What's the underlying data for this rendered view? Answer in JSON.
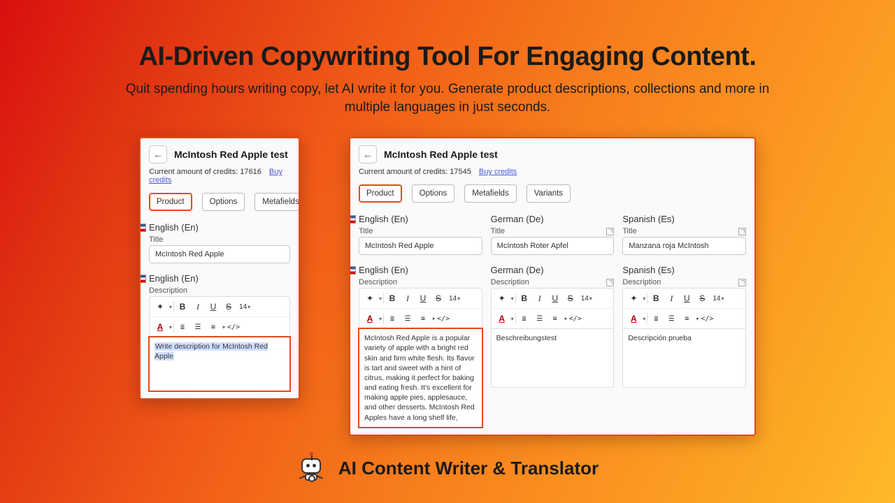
{
  "hero": {
    "title": "AI-Driven Copywriting Tool For Engaging Content.",
    "subtitle": "Quit spending hours writing copy, let AI write it for you. Generate product descriptions, collections and more in multiple languages in just seconds."
  },
  "footer": {
    "name": "AI Content Writer & Translator"
  },
  "left": {
    "product_title": "McIntosh Red Apple test",
    "credits_prefix": "Current amount of credits: ",
    "credits_value": "17616",
    "buy_link": "Buy credits",
    "tabs": [
      "Product",
      "Options",
      "Metafields"
    ],
    "lang": "English (En)",
    "title_label": "Title",
    "title_value": "McIntosh Red Apple",
    "desc_label": "Description",
    "prompt_text": "Write description for McIntosh Red Apple"
  },
  "right": {
    "product_title": "McIntosh Red Apple test",
    "credits_prefix": "Current amount of credits: ",
    "credits_value": "17545",
    "buy_link": "Buy credits",
    "tabs": [
      "Product",
      "Options",
      "Metafields",
      "Variants"
    ],
    "cols": [
      {
        "lang": "English (En)",
        "title_label": "Title",
        "title_value": "McIntosh Red Apple",
        "desc_label": "Description",
        "desc_value": "McIntosh Red Apple is a popular variety of apple with a bright red skin and firm white flesh. Its flavor is tart and sweet with a hint of citrus, making it perfect for baking and eating fresh. It's excellent for making apple pies, applesauce, and other desserts. McIntosh Red Apples have a long shelf life,"
      },
      {
        "lang": "German (De)",
        "title_label": "Title",
        "title_value": "McIntosh Roter Apfel",
        "desc_label": "Description",
        "desc_value": "Beschreibungstest"
      },
      {
        "lang": "Spanish (Es)",
        "title_label": "Title",
        "title_value": "Manzana roja McIntosh",
        "desc_label": "Description",
        "desc_value": "Descripción prueba"
      }
    ]
  },
  "toolbar": {
    "size": "14",
    "B": "B",
    "I": "I",
    "U": "U",
    "S": "S",
    "A": "A",
    "code": "</>"
  }
}
